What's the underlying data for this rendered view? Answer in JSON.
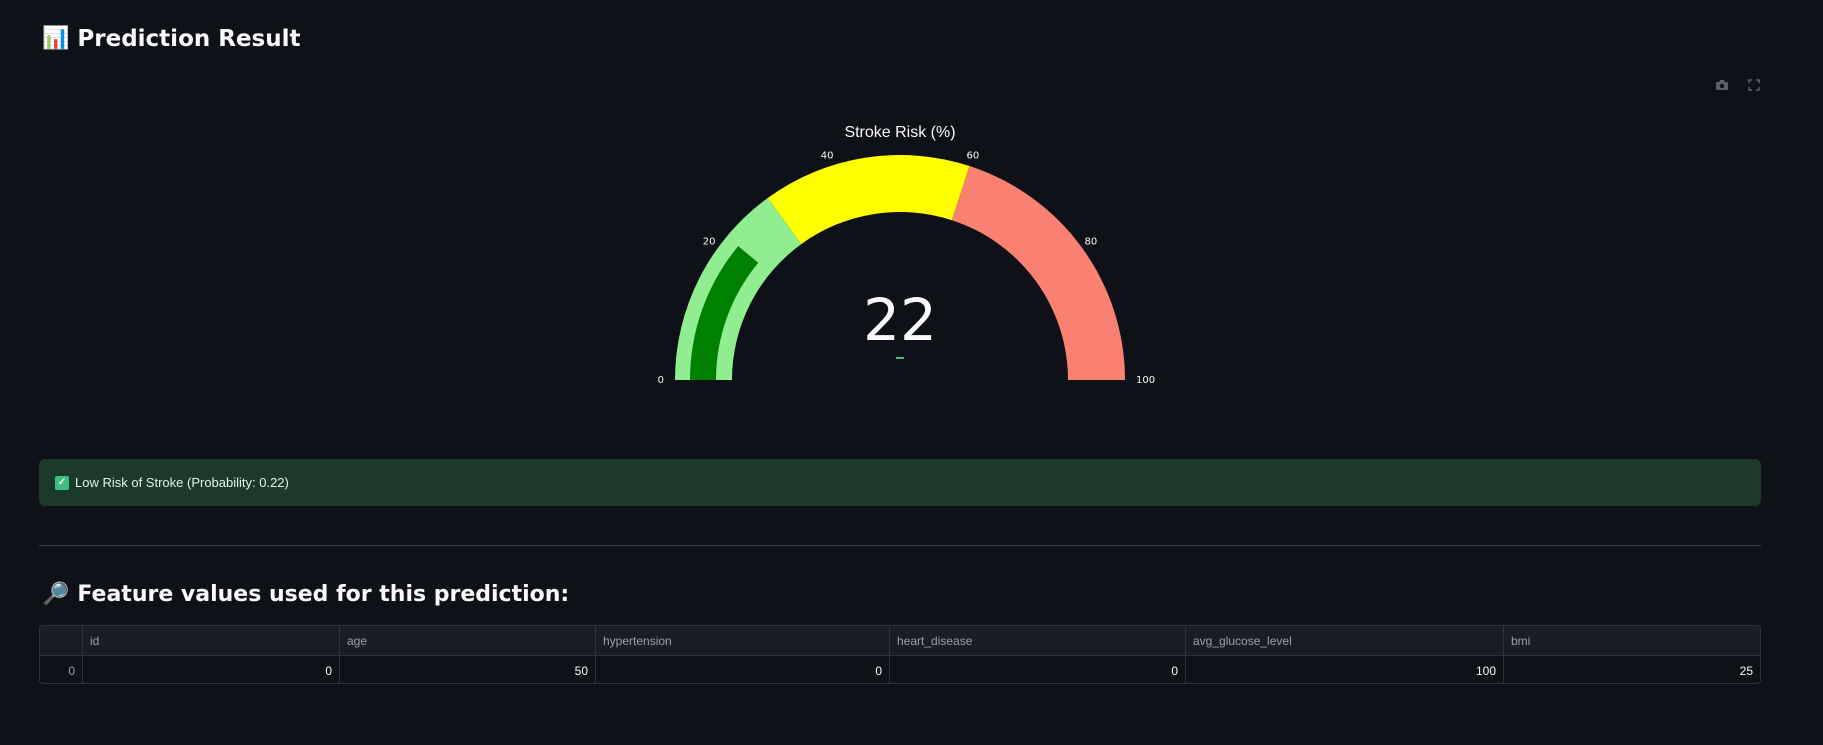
{
  "header": {
    "icon": "bar-chart-icon",
    "emoji": "📊",
    "title": "Prediction Result"
  },
  "toolbar": {
    "items": [
      "camera-icon",
      "fullscreen-icon"
    ]
  },
  "chart_data": {
    "type": "gauge",
    "title": "Stroke Risk (%)",
    "value": 22,
    "range": [
      0,
      100
    ],
    "ticks": [
      0,
      20,
      40,
      60,
      80,
      100
    ],
    "steps": [
      {
        "range": [
          0,
          30
        ],
        "color": "#90ee90"
      },
      {
        "range": [
          30,
          60
        ],
        "color": "#ffff00"
      },
      {
        "range": [
          60,
          100
        ],
        "color": "#fa8072"
      }
    ],
    "bar_color": "#008000"
  },
  "alert": {
    "icon": "check-icon",
    "text": "Low Risk of Stroke (Probability: 0.22)"
  },
  "features": {
    "icon": "magnifier-icon",
    "emoji": "🔎",
    "title": "Feature values used for this prediction:",
    "columns": [
      "",
      "id",
      "age",
      "hypertension",
      "heart_disease",
      "avg_glucose_level",
      "bmi"
    ],
    "rows": [
      [
        "0",
        "0",
        "50",
        "0",
        "0",
        "100",
        "25"
      ]
    ]
  }
}
